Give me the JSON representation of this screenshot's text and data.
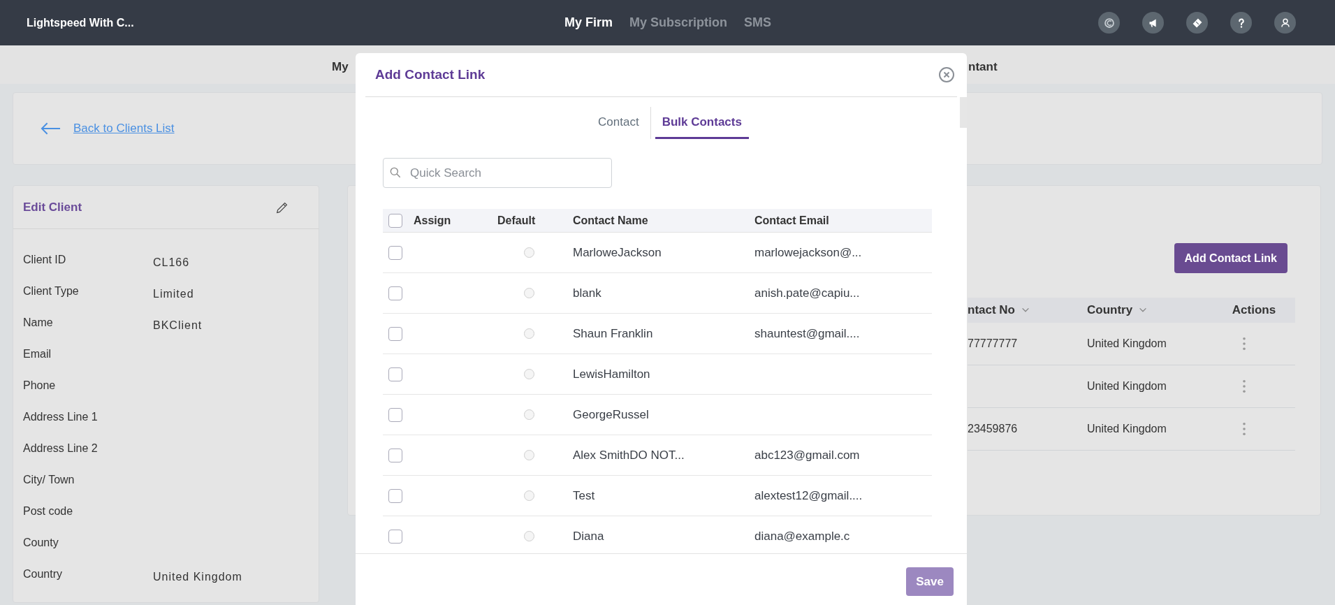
{
  "top_bar": {
    "app_title": "Lightspeed With C...",
    "nav": [
      {
        "label": "My Firm",
        "selected": true
      },
      {
        "label": "My Subscription",
        "selected": false
      },
      {
        "label": "SMS",
        "selected": false
      }
    ]
  },
  "sub_nav": {
    "left_text": "My",
    "right_text": "ntant"
  },
  "back_link": "Back to Clients List",
  "edit_client": {
    "title": "Edit Client",
    "fields": [
      {
        "label": "Client ID",
        "value": "CL166"
      },
      {
        "label": "Client Type",
        "value": "Limited"
      },
      {
        "label": "Name",
        "value": "BKClient"
      },
      {
        "label": "Email"
      },
      {
        "label": "Phone"
      },
      {
        "label": "Address Line 1"
      },
      {
        "label": "Address Line 2"
      },
      {
        "label": "City/ Town"
      },
      {
        "label": "Post code"
      },
      {
        "label": "County"
      },
      {
        "label": "Country",
        "value": "United Kingdom"
      }
    ]
  },
  "contacts_panel": {
    "add_button": "Add Contact Link",
    "columns": [
      {
        "label": "ntact No",
        "sortable": true
      },
      {
        "label": "Country",
        "sortable": true
      },
      {
        "label": "Actions",
        "sortable": false
      }
    ],
    "rows": [
      {
        "column_1": "77777777",
        "country": "United Kingdom"
      },
      {
        "country": "United Kingdom"
      },
      {
        "column_1": "23459876",
        "country": "United Kingdom"
      }
    ]
  },
  "modal": {
    "title": "Add Contact Link",
    "tabs": [
      {
        "label": "Contact",
        "selected": false
      },
      {
        "label": "Bulk Contacts",
        "selected": true
      }
    ],
    "search": {
      "placeholder": "Quick Search"
    },
    "table": {
      "select_all": {
        "checked": false
      },
      "columns": [
        "Assign",
        "Default",
        "Contact Name",
        "Contact Email"
      ],
      "rows": [
        {
          "assign": false,
          "default": false,
          "name": "MarloweJackson",
          "email": "marlowejackson@..."
        },
        {
          "assign": false,
          "default": false,
          "name": "blank",
          "email": "anish.pate@capiu..."
        },
        {
          "assign": false,
          "default": false,
          "name": "Shaun Franklin",
          "email": "shauntest@gmail...."
        },
        {
          "assign": false,
          "default": false,
          "name": "LewisHamilton"
        },
        {
          "assign": false,
          "default": false,
          "name": "GeorgeRussel"
        },
        {
          "assign": false,
          "default": false,
          "name": "Alex SmithDO NOT...",
          "email": "abc123@gmail.com"
        },
        {
          "assign": false,
          "default": false,
          "name": "Test",
          "email": "alextest12@gmail...."
        },
        {
          "assign": false,
          "default": false,
          "name": "Diana",
          "email": "diana@example.c"
        }
      ]
    },
    "save_button": {
      "label": "Save",
      "disabled": true
    }
  }
}
